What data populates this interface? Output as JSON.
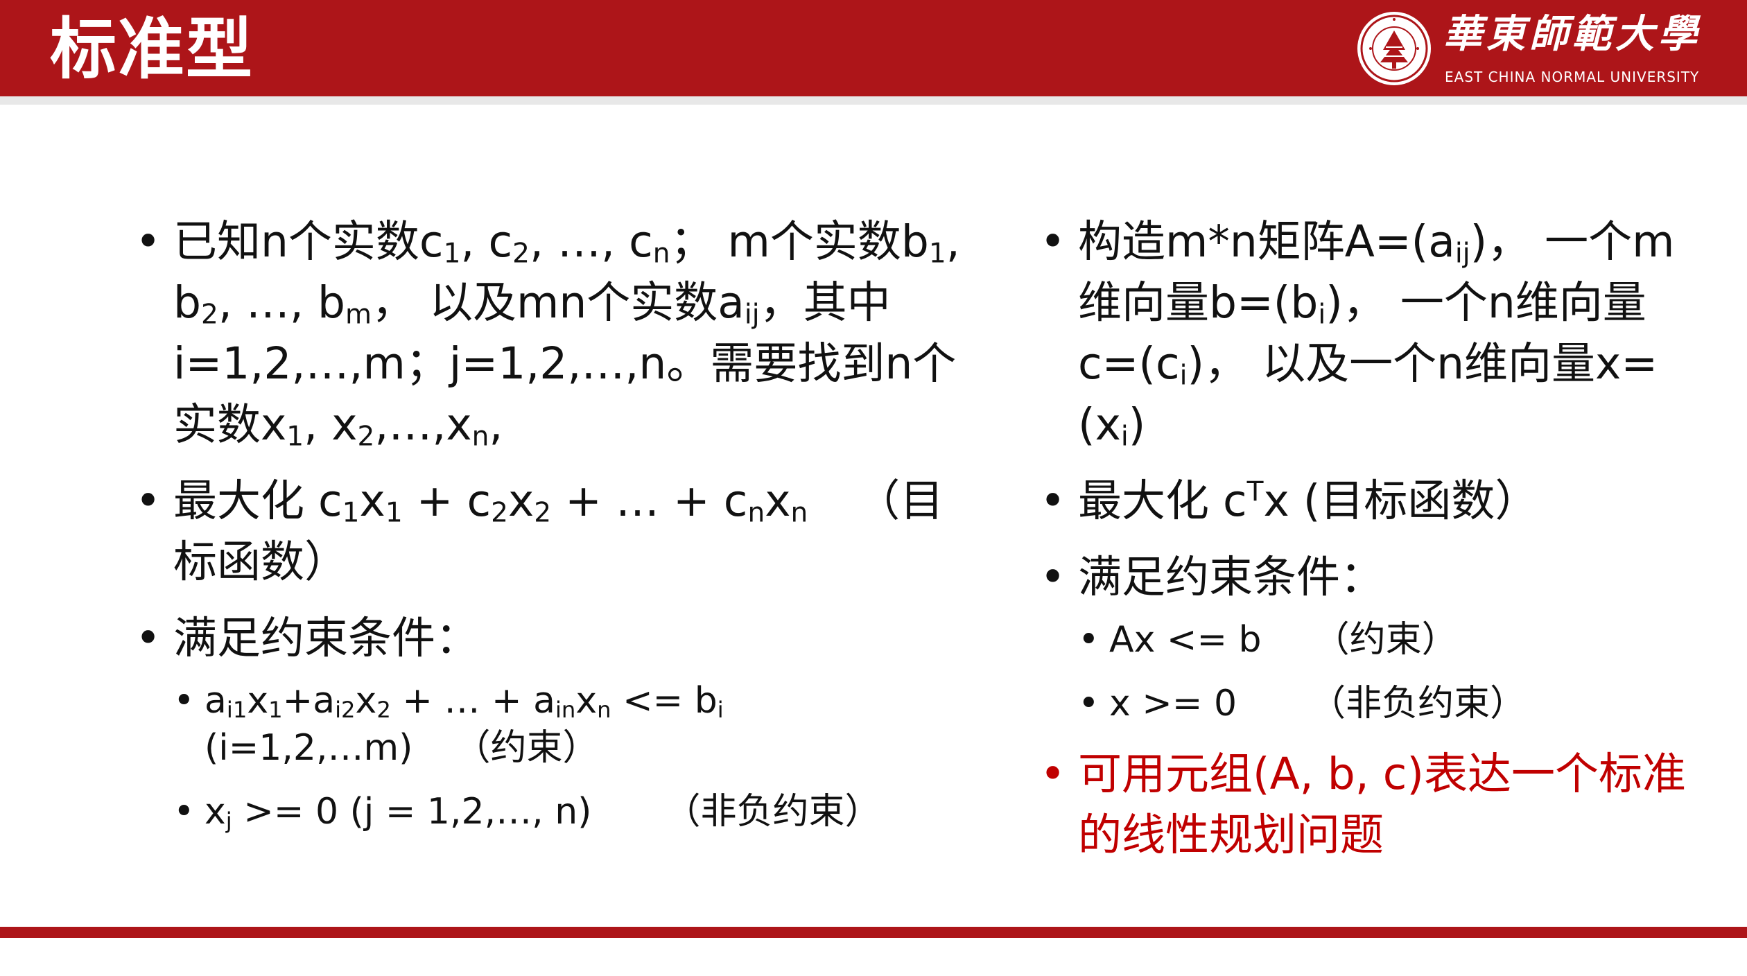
{
  "header": {
    "title": "标准型",
    "logo_cn": "華東師範大學",
    "logo_en": "EAST CHINA NORMAL UNIVERSITY"
  },
  "colors": {
    "brand_red": "#ad1519",
    "highlight_red": "#c00000"
  },
  "icons": [
    "university-seal-icon"
  ],
  "left": {
    "b1": {
      "t1": "已知n个实数c",
      "s1": "1",
      "t2": ", c",
      "s2": "2",
      "t3": ", …, c",
      "s3": "n",
      "t4": "；  m个实数b",
      "s4": "1",
      "t5": ", b",
      "s5": "2",
      "t6": ", …, b",
      "s6": "m",
      "t7": "，  以及mn个实数a",
      "s7": "ij",
      "t8": "，其中i=1,2,…,m；j=1,2,…,n。需要找到n个实数x",
      "s8": "1",
      "t9": ", x",
      "s9": "2",
      "t10": ",…,x",
      "s10": "n",
      "t11": ","
    },
    "b2": {
      "t1": "最大化  c",
      "s1": "1",
      "t2": "x",
      "s2": "1",
      "t3": " + c",
      "s3": "2",
      "t4": "x",
      "s4": "2",
      "t5": " + … + c",
      "s5": "n",
      "t6": "x",
      "s6": "n",
      "t7": "（目标函数）"
    },
    "b3": {
      "text": "满足约束条件：",
      "sub1": {
        "t1": "a",
        "s1": "i1",
        "t2": "x",
        "s2": "1",
        "t3": "+a",
        "s3": "i2",
        "t4": "x",
        "s4": "2",
        "t5": " + … + a",
        "s5": "in",
        "t6": "x",
        "s6": "n",
        "t7": " <= b",
        "s7": "i",
        "t8": " (i=1,2,…m)",
        "note": "（约束）"
      },
      "sub2": {
        "t1": "x",
        "s1": "j",
        "t2": " >= 0 (j = 1,2,…, n)",
        "note": "（非负约束）"
      }
    }
  },
  "right": {
    "b1": {
      "t1": "构造m*n矩阵A=(a",
      "s1": "ij",
      "t2": ")，  一个m维向量b=(b",
      "s2": "i",
      "t3": ")，  一个n维向量c=(c",
      "s3": "i",
      "t4": ")，  以及一个n维向量x=(x",
      "s4": "i",
      "t5": ")"
    },
    "b2": {
      "t1": "最大化 c",
      "sup1": "T",
      "t2": "x (目标函数）"
    },
    "b3": {
      "text": "满足约束条件：",
      "sub1": {
        "expr": "Ax <= b",
        "note": "（约束）"
      },
      "sub2": {
        "expr": "x >= 0",
        "note": "（非负约束）"
      }
    },
    "b4": {
      "text": "可用元组(A, b, c)表达一个标准的线性规划问题"
    }
  }
}
